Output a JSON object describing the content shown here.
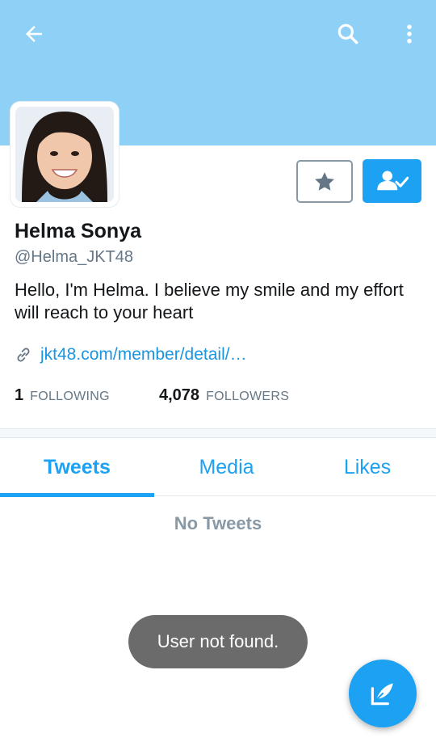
{
  "profile": {
    "display_name": "Helma Sonya",
    "handle": "@Helma_JKT48",
    "bio": "Hello, I'm Helma. I believe my smile and my effort will reach to your heart",
    "link": "jkt48.com/member/detail/…"
  },
  "stats": {
    "following_count": "1",
    "following_label": "FOLLOWING",
    "followers_count": "4,078",
    "followers_label": "FOLLOWERS"
  },
  "tabs": [
    {
      "label": "Tweets",
      "active": true
    },
    {
      "label": "Media",
      "active": false
    },
    {
      "label": "Likes",
      "active": false
    }
  ],
  "timeline": {
    "empty_message": "No Tweets"
  },
  "toast": {
    "message": "User not found."
  },
  "colors": {
    "banner": "#8fd0f7",
    "accent": "#1da1f2",
    "link": "#1b95e0",
    "muted": "#657786"
  },
  "icons": {
    "back": "back-arrow-icon",
    "search": "search-icon",
    "more": "more-vertical-icon",
    "star": "star-icon",
    "follow": "user-check-icon",
    "link": "link-icon",
    "compose": "compose-tweet-icon"
  }
}
